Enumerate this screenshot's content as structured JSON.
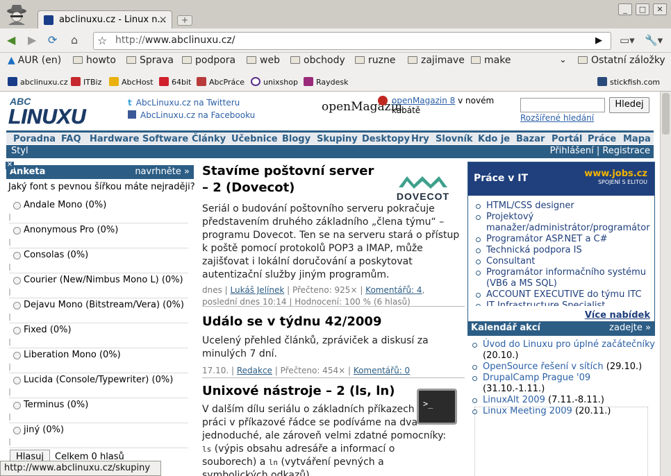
{
  "browser": {
    "tab_title": "abclinuxu.cz - Linux n...",
    "url_scheme": "http://",
    "url_host": "www.abclinuxu.cz/",
    "bookmarks_folders": [
      {
        "label": "AUR (en)"
      },
      {
        "label": "howto"
      },
      {
        "label": "Sprava"
      },
      {
        "label": "podpora"
      },
      {
        "label": "web"
      },
      {
        "label": "obchody"
      },
      {
        "label": "ruzne"
      },
      {
        "label": "zajimave"
      },
      {
        "label": "make"
      }
    ],
    "other_bookmarks": "Ostatní záložky",
    "bookmarks_sites": [
      {
        "label": "abclinuxu.cz"
      },
      {
        "label": "ITBiz"
      },
      {
        "label": "AbcHost"
      },
      {
        "label": "64bit"
      },
      {
        "label": "AbcPráce"
      },
      {
        "label": "unixshop"
      },
      {
        "label": "Raydesk"
      }
    ],
    "stickfish": "stickfish.com",
    "status_url": "http://www.abclinuxu.cz/skupiny"
  },
  "header": {
    "twitter": "AbcLinuxu.cz na Twitteru",
    "facebook": "AbcLinuxu.cz na Facebooku",
    "openmag_brand": "openMagazin",
    "openmag_link": "openMagazin 8",
    "openmag_rest1": " v novém",
    "openmag_rest2": "kabátě",
    "search_button": "Hledej",
    "advanced_search": "Rozšířené hledání"
  },
  "nav": {
    "items": [
      "Poradna",
      "FAQ",
      "Hardware",
      "Software",
      "Články",
      "Učebnice",
      "Blogy",
      "Skupiny",
      "Desktopy",
      "Hry",
      "Slovník",
      "Kdo je",
      "Bazar",
      "Portál",
      "Práce",
      "Mapa"
    ],
    "style": "Styl",
    "login": "Přihlášení",
    "divider": "|",
    "register": "Registrace"
  },
  "poll": {
    "title": "Anketa",
    "suggest": "navrhněte »",
    "close": "✕",
    "question": "Jaký font s pevnou šířkou máte nejraději?",
    "options": [
      {
        "label": "Andale Mono (0%)"
      },
      {
        "label": "Anonymous Pro (0%)"
      },
      {
        "label": "Consolas (0%)"
      },
      {
        "label": "Courier (New/Nimbus Mono L) (0%)"
      },
      {
        "label": "Dejavu Mono (Bitstream/Vera) (0%)"
      },
      {
        "label": "Fixed (0%)"
      },
      {
        "label": "Liberation Mono (0%)"
      },
      {
        "label": "Lucida (Console/Typewriter) (0%)"
      },
      {
        "label": "Terminus (0%)"
      },
      {
        "label": "jiný (0%)"
      }
    ],
    "vote_button": "Hlasuj",
    "total": "Celkem 0 hlasů"
  },
  "articles": [
    {
      "title": "Stavíme poštovní server – 2 (Dovecot)",
      "body": "Seriál o budování poštovního serveru pokračuje představením druhého základního „člena týmu“ – programu Dovecot. Ten se na serveru stará o přístup k poště pomocí protokolů POP3 a IMAP, může zajišťovat i lokální doručování a poskytovat autentizační služby jiným programům.",
      "logo": "DOVECOT",
      "meta_date": "dnes",
      "author": "Lukáš Jelínek",
      "reads": "Přečteno: 925×",
      "comments": "Komentářů: 4",
      "last": "poslední dnes 10:14",
      "rating": "Hodnocení: 100 % (6 hlasů)"
    },
    {
      "title": "Událo se v týdnu 42/2009",
      "body": "Ucelený přehled článků, zpráviček a diskusí za minulých 7 dní.",
      "meta_date": "17.10.",
      "author": "Redakce",
      "reads": "Přečteno: 454×",
      "comments": "Komentářů: 0"
    },
    {
      "title": "Unixové nástroje – 2 (ls, ln)",
      "body1": "V dalším dílu seriálu o základních příkazech pro práci v příkazové řádce se podíváme na dva jednoduché, ale zároveň velmi zdatné pomocníky: ",
      "cmd1": "ls",
      "body2": " (výpis obsahu adresáře a informací o souborech) a ",
      "cmd2": "ln",
      "body3": " (vytváření pevných a symbolických odkazů)."
    }
  ],
  "jobs": {
    "title": "Práce v IT",
    "logo": "www.jobs.cz",
    "logo_sub": "SPOJENÍ S ELITOU",
    "items": [
      "HTML/CSS designer",
      "Projektový manažer/administrátor/programátor",
      "Programátor ASP.NET a C#",
      "Technická podpora IS",
      "Consultant",
      "Programátor informačního systému (VB6 a MS SQL)",
      "ACCOUNT EXECUTIVE do týmu ITC",
      "IT Infrastructure Specialist"
    ],
    "more": "Více nabídek"
  },
  "calendar": {
    "title": "Kalendář akcí",
    "submit": "zadejte »",
    "events": [
      {
        "name": "Úvod do Linuxu pro úplné začátečníky",
        "date": "(20.10.)"
      },
      {
        "name": "OpenSource řešení v sítích",
        "date": "(29.10.)"
      },
      {
        "name": "DrupalCamp Prague '09",
        "date": "(31.10.-1.11.)"
      },
      {
        "name": "LinuxAlt 2009",
        "date": "(7.11.-8.11.)"
      },
      {
        "name": "Linux Meeting 2009",
        "date": "(20.11.)"
      }
    ]
  },
  "colors": {
    "nav_blue": "#2c5d85",
    "link": "#2a5fa5",
    "jobs_navy": "#1f3f7d"
  }
}
